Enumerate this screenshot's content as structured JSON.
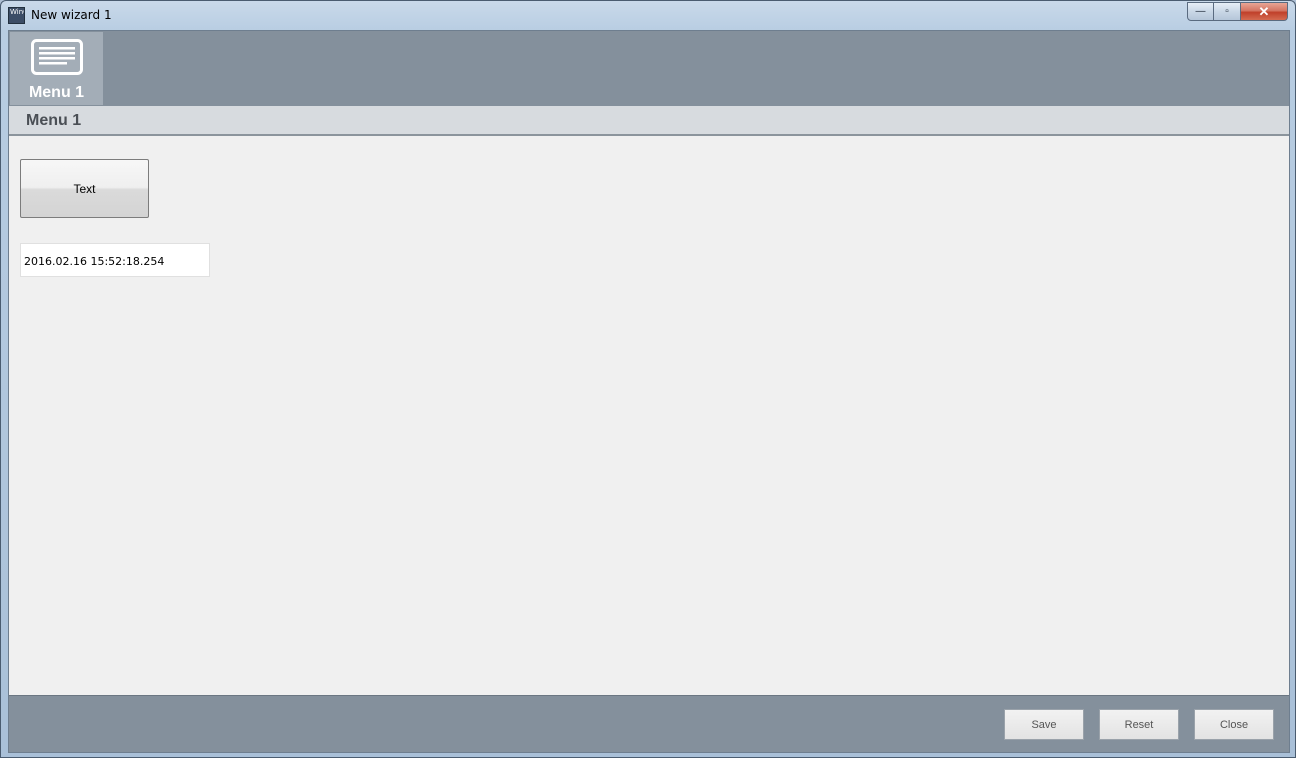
{
  "window": {
    "title": "New wizard 1",
    "app_icon_text": "WinCC",
    "controls": {
      "minimize": "—",
      "maximize": "▫",
      "close": "✕"
    }
  },
  "topbar": {
    "menu_tile": {
      "label": "Menu 1",
      "icon": "menu-list-icon"
    }
  },
  "section": {
    "title": "Menu 1"
  },
  "content": {
    "text_button_label": "Text",
    "datetime_value": "2016.02.16 15:52:18.254"
  },
  "footer": {
    "save_label": "Save",
    "reset_label": "Reset",
    "close_label": "Close"
  },
  "colors": {
    "topbar_bg": "#84909c",
    "menu_tile_bg": "#a3adb7",
    "section_bg": "#d7dbdf",
    "client_bg": "#f0f0f0"
  }
}
